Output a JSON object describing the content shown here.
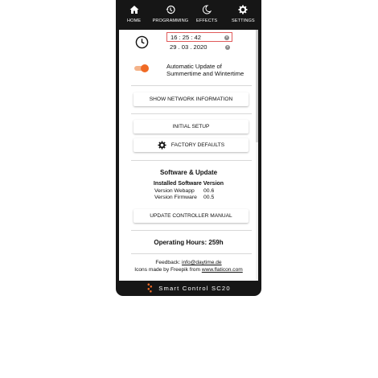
{
  "nav": {
    "items": [
      {
        "label": "HOME",
        "icon": "home-icon"
      },
      {
        "label": "PROGRAMMING",
        "icon": "history-icon"
      },
      {
        "label": "EFFECTS",
        "icon": "moon-icon"
      },
      {
        "label": "SETTINGS",
        "icon": "gear-icon"
      }
    ]
  },
  "datetime": {
    "time": "16 : 25 : 42",
    "date": "29 . 03 . 2020"
  },
  "dst": {
    "label_line1": "Automatic Update of",
    "label_line2": "Summertime and Wintertime",
    "enabled": true
  },
  "buttons": {
    "network": "SHOW NETWORK INFORMATION",
    "initial_setup": "INITIAL SETUP",
    "factory_defaults": "FACTORY DEFAULTS",
    "manual": "UPDATE CONTROLLER MANUAL"
  },
  "software": {
    "title": "Software & Update",
    "installed_title": "Installed Software Version",
    "webapp_label": "Version Webapp",
    "webapp_value": "00.6",
    "firmware_label": "Version Firmware",
    "firmware_value": "00.5"
  },
  "hours": {
    "label": "Operating Hours:",
    "value": "259h"
  },
  "info": {
    "feedback_label": "Feedback:",
    "feedback_email": "info@daytime.de",
    "credits_prefix": "Icons made by Freepik from",
    "credits_link": "www.flaticon.com"
  },
  "footer": {
    "title": "Smart Control SC20"
  },
  "colors": {
    "frame": "#161616",
    "accent": "#f06a25",
    "time_border": "#e05a5a"
  }
}
